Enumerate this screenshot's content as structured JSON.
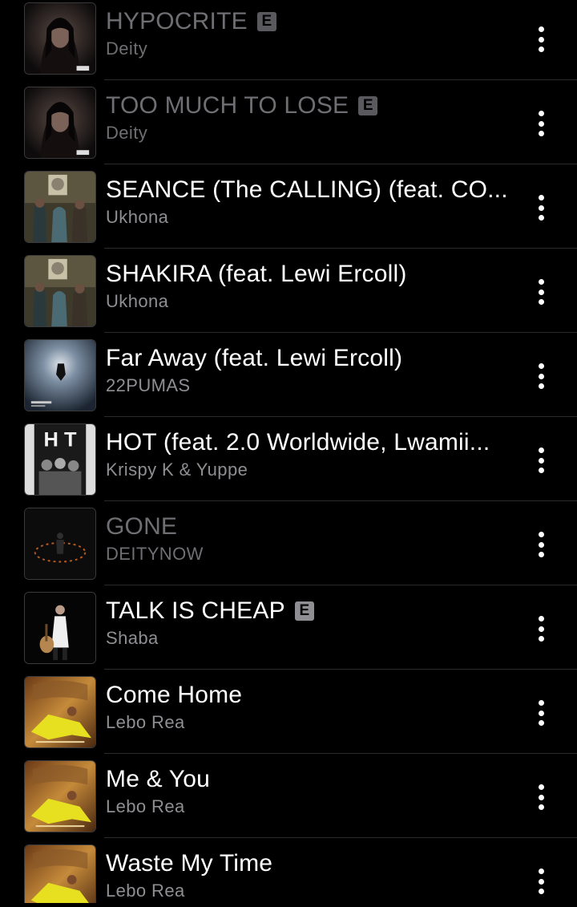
{
  "songs": [
    {
      "title": "HYPOCRITE",
      "artist": "Deity",
      "explicit": true,
      "dim": true,
      "art": "dark-portrait"
    },
    {
      "title": "TOO MUCH TO LOSE",
      "artist": "Deity",
      "explicit": true,
      "dim": true,
      "art": "dark-portrait"
    },
    {
      "title": "SEANCE (The CALLING) (feat. CO...",
      "artist": "Ukhona",
      "explicit": false,
      "dim": false,
      "art": "group-photo"
    },
    {
      "title": "SHAKIRA (feat. Lewi Ercoll)",
      "artist": "Ukhona",
      "explicit": false,
      "dim": false,
      "art": "group-photo"
    },
    {
      "title": "Far Away (feat. Lewi Ercoll)",
      "artist": "22PUMAS",
      "explicit": false,
      "dim": false,
      "art": "sky-figure"
    },
    {
      "title": "HOT (feat. 2.0 Worldwide, Lwamii...",
      "artist": "Krispy K & Yuppe",
      "explicit": false,
      "dim": false,
      "art": "bw-group"
    },
    {
      "title": "GONE",
      "artist": "DEITYNOW",
      "explicit": false,
      "dim": true,
      "art": "fire-ring"
    },
    {
      "title": "TALK IS CHEAP",
      "artist": "Shaba",
      "explicit": true,
      "dim": false,
      "art": "guitar-woman"
    },
    {
      "title": "Come Home",
      "artist": "Lebo Rea",
      "explicit": false,
      "dim": false,
      "art": "gold-yellow"
    },
    {
      "title": "Me & You",
      "artist": "Lebo Rea",
      "explicit": false,
      "dim": false,
      "art": "gold-yellow"
    },
    {
      "title": "Waste My Time",
      "artist": "Lebo Rea",
      "explicit": false,
      "dim": false,
      "art": "gold-yellow"
    }
  ],
  "explicit_label": "E",
  "icons": {
    "more": "more-vertical-icon",
    "explicit": "explicit-badge"
  },
  "colors": {
    "background": "#000000",
    "title": "#ffffff",
    "dimmed": "#6e6e73",
    "subtitle": "#8e8e93"
  }
}
